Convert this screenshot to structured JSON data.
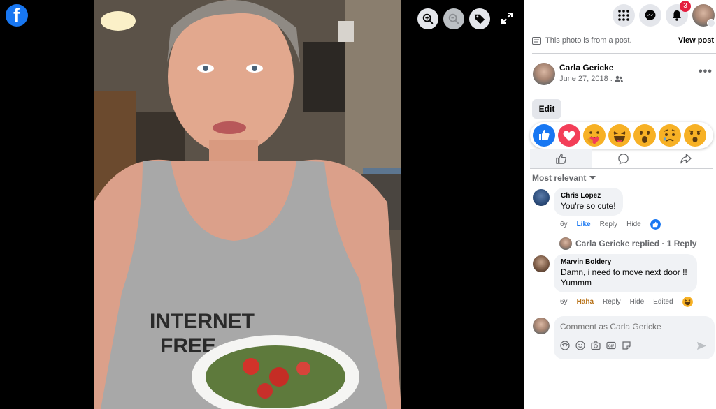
{
  "viewer": {
    "logo_letter": "f",
    "toolbar": [
      "zoom-in-icon",
      "zoom-out-icon",
      "tag-icon",
      "fullscreen-icon"
    ]
  },
  "topbar": {
    "notification_count": "3"
  },
  "post": {
    "note": "This photo is from a post.",
    "view_post": "View post",
    "author": "Carla Gericke",
    "date": "June 27, 2018 .",
    "edit_label": "Edit"
  },
  "reactions": [
    "like",
    "love",
    "care",
    "haha",
    "wow",
    "sad",
    "angry"
  ],
  "comments_filter": "Most relevant",
  "comments": [
    {
      "name": "Chris Lopez",
      "text": "You're so cute!",
      "age": "6y",
      "like": "Like",
      "reply": "Reply",
      "hide": "Hide"
    },
    {
      "name": "Marvin Boldery",
      "text_line1": "Damn, i need to move next door !!",
      "text_line2": "Yummm",
      "age": "6y",
      "like": "Haha",
      "reply": "Reply",
      "hide": "Hide",
      "edited": "Edited"
    }
  ],
  "replied": "Carla Gericke replied · 1 Reply",
  "composer": {
    "placeholder": "Comment as Carla Gericke"
  },
  "colors": {
    "brand": "#1877f2",
    "badge": "#e41e3f",
    "haha": "#b8731a"
  }
}
